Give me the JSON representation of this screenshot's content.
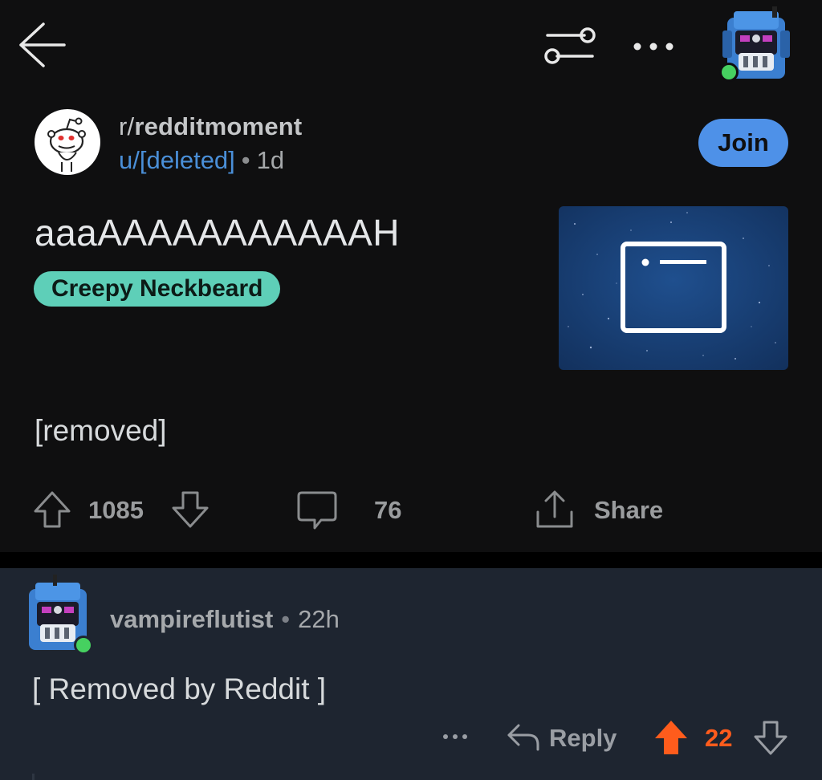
{
  "header": {
    "back_icon": "arrow-left-icon",
    "filter_icon": "sliders-icon",
    "more_icon": "more-horizontal-icon",
    "avatar_icon": "robot-avatar-icon",
    "online_color": "#46d160"
  },
  "post": {
    "subreddit_prefix": "r/",
    "subreddit_name": "redditmoment",
    "author": "u/[deleted]",
    "separator": "•",
    "age": "1d",
    "join_label": "Join",
    "title": "aaaAAAAAAAAAAAH",
    "flair": "Creepy Neckbeard",
    "flair_color": "#5ecfb8",
    "body": "[removed]",
    "upvotes": "1085",
    "comments": "76",
    "share_label": "Share"
  },
  "comment": {
    "username": "vampireflutist",
    "separator": "•",
    "age": "22h",
    "body": "[ Removed by Reddit ]",
    "more_label": "•••",
    "reply_label": "Reply",
    "score": "22",
    "score_color": "#ff5c1c"
  }
}
